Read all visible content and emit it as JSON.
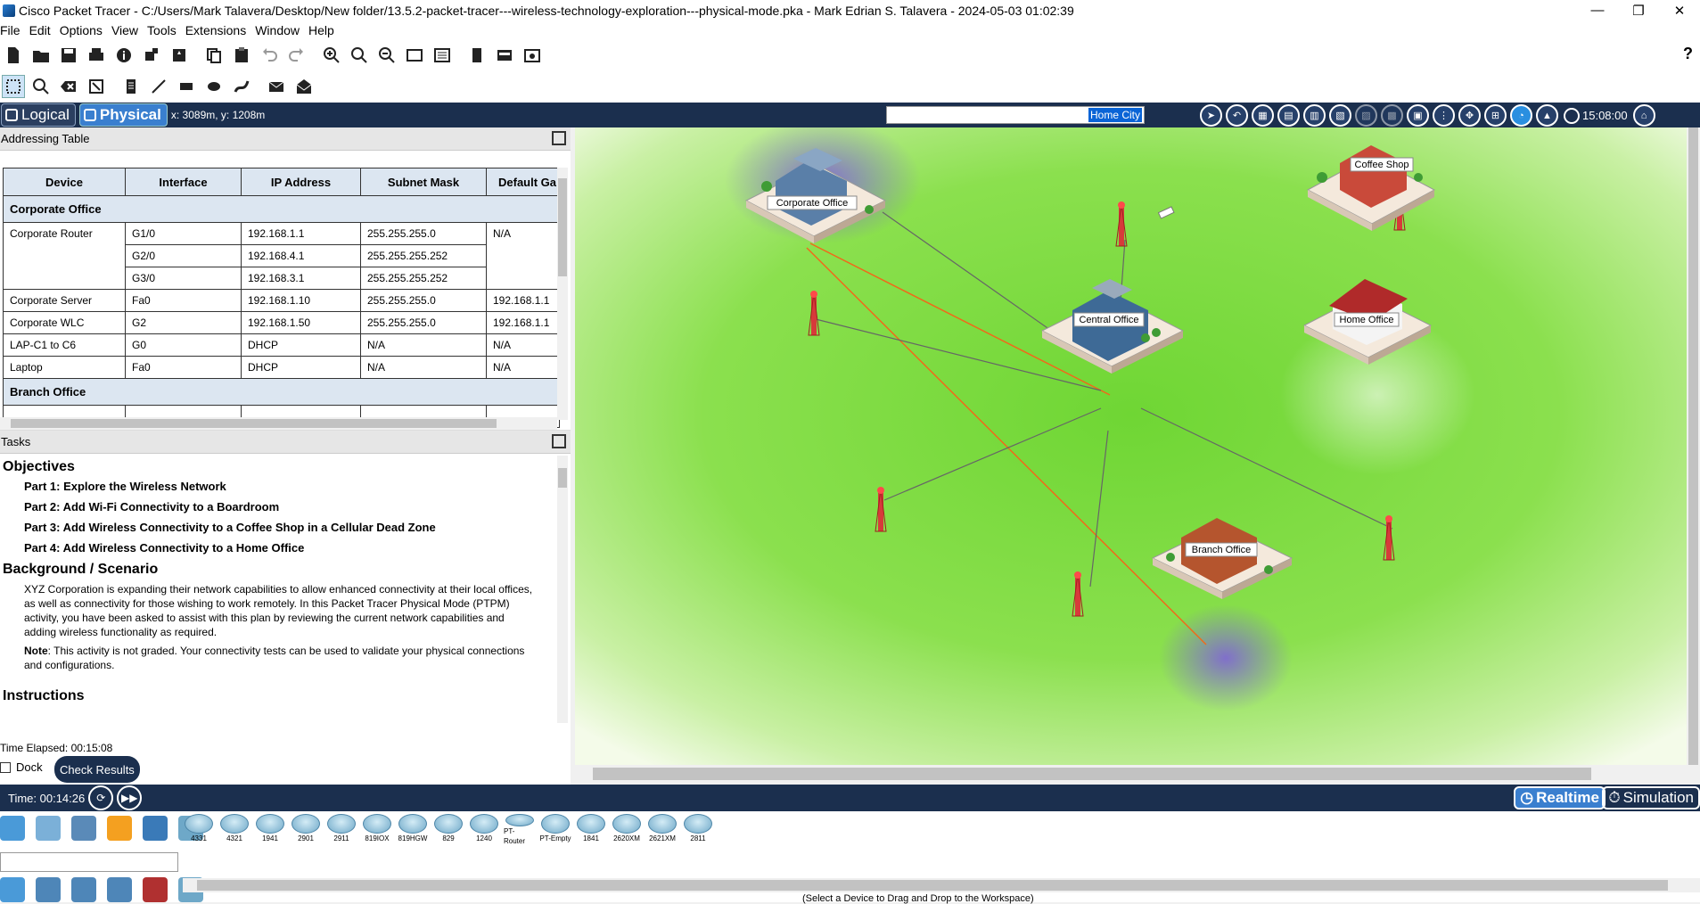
{
  "window": {
    "title": "Cisco Packet Tracer - C:/Users/Mark Talavera/Desktop/New folder/13.5.2-packet-tracer---wireless-technology-exploration---physical-mode.pka - Mark Edrian S. Talavera - 2024-05-03 01:02:39",
    "minimize": "—",
    "restore": "❐",
    "close": "✕"
  },
  "menu": [
    "File",
    "Edit",
    "Options",
    "View",
    "Tools",
    "Extensions",
    "Window",
    "Help"
  ],
  "help_icon": "?",
  "mode": {
    "logical": "Logical",
    "physical": "Physical",
    "coords": "x: 3089m, y: 1208m",
    "location": "Home City",
    "clock": "15:08:00"
  },
  "addressing": {
    "header": "Addressing Table",
    "columns": [
      "Device",
      "Interface",
      "IP Address",
      "Subnet Mask",
      "Default Ga"
    ],
    "groups": [
      {
        "name": "Corporate Office",
        "rows": [
          {
            "device": "Corporate Router",
            "iface": "G1/0",
            "ip": "192.168.1.1",
            "mask": "255.255.255.0",
            "gw": "N/A"
          },
          {
            "device": "",
            "iface": "G2/0",
            "ip": "192.168.4.1",
            "mask": "255.255.255.252",
            "gw": ""
          },
          {
            "device": "",
            "iface": "G3/0",
            "ip": "192.168.3.1",
            "mask": "255.255.255.252",
            "gw": ""
          },
          {
            "device": "Corporate Server",
            "iface": "Fa0",
            "ip": "192.168.1.10",
            "mask": "255.255.255.0",
            "gw": "192.168.1.1"
          },
          {
            "device": "Corporate WLC",
            "iface": "G2",
            "ip": "192.168.1.50",
            "mask": "255.255.255.0",
            "gw": "192.168.1.1"
          },
          {
            "device": "LAP-C1 to C6",
            "iface": "G0",
            "ip": "DHCP",
            "mask": "N/A",
            "gw": "N/A"
          },
          {
            "device": "Laptop",
            "iface": "Fa0",
            "ip": "DHCP",
            "mask": "N/A",
            "gw": "N/A"
          }
        ]
      },
      {
        "name": "Branch Office",
        "rows": []
      }
    ]
  },
  "tasks": {
    "header": "Tasks",
    "objectives_title": "Objectives",
    "parts": [
      "Part 1: Explore the Wireless Network",
      "Part 2: Add Wi-Fi Connectivity to a Boardroom",
      "Part 3: Add Wireless Connectivity to a Coffee Shop in a Cellular Dead Zone",
      "Part 4: Add Wireless Connectivity to a Home Office"
    ],
    "background_title": "Background / Scenario",
    "background_text": "XYZ Corporation is expanding their network capabilities to allow enhanced connectivity at their local offices, as well as connectivity for those wishing to work remotely. In this Packet Tracer Physical Mode (PTPM) activity, you have been asked to assist with this plan by reviewing the current network capabilities and adding wireless functionality as required.",
    "note_label": "Note",
    "note_text": ": This activity is not graded. Your connectivity tests can be used to validate your physical connections and configurations.",
    "instructions_title": "Instructions"
  },
  "bottom_left": {
    "elapsed": "Time Elapsed: 00:15:08",
    "dock": "Dock",
    "check": "Check Results"
  },
  "map": {
    "buildings": [
      "Corporate Office",
      "Coffee Shop",
      "Central Office",
      "Home Office",
      "Branch Office"
    ]
  },
  "status": {
    "time": "Time: 00:14:26",
    "realtime": "Realtime",
    "simulation": "Simulation"
  },
  "devices": [
    "4331",
    "4321",
    "1941",
    "2901",
    "2911",
    "819IOX",
    "819HGW",
    "829",
    "1240",
    "PT-Router",
    "PT-Empty",
    "1841",
    "2620XM",
    "2621XM",
    "2811"
  ],
  "hint": "(Select a Device to Drag and Drop to the Workspace)",
  "colors": {
    "navy": "#1b2f4e",
    "accent": "#3a7fcf",
    "grass": "#8be04e"
  }
}
